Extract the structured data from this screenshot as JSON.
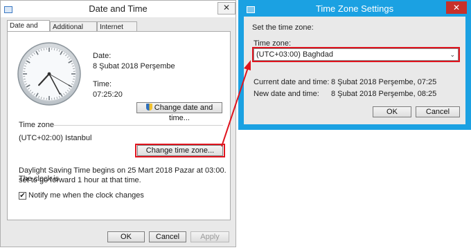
{
  "date_time_window": {
    "title": "Date and Time",
    "close_glyph": "✕",
    "tabs": [
      {
        "label": "Date and Time"
      },
      {
        "label": "Additional Clocks"
      },
      {
        "label": "Internet Time"
      }
    ],
    "date_label": "Date:",
    "date_value": "8 Şubat 2018 Perşembe",
    "time_label": "Time:",
    "time_value": "07:25:20",
    "change_date_button": "Change date and time...",
    "time_zone_heading": "Time zone",
    "time_zone_value": "(UTC+02:00) Istanbul",
    "change_time_zone_button": "Change time zone...",
    "dst_text_line1": "Daylight Saving Time begins on 25 Mart 2018 Pazar at 03:00. The clock is",
    "dst_text_line2": "set to go forward 1 hour at that time.",
    "notify_label": "Notify me when the clock changes",
    "notify_checked": true,
    "buttons": {
      "ok": "OK",
      "cancel": "Cancel",
      "apply": "Apply"
    }
  },
  "time_zone_window": {
    "title": "Time Zone Settings",
    "close_glyph": "✕",
    "instruction": "Set the time zone:",
    "field_label": "Time zone:",
    "selected_zone": "(UTC+03:00) Baghdad",
    "current_label": "Current date and time:",
    "current_value": "8 Şubat 2018 Perşembe, 07:25",
    "new_label": "New date and time:",
    "new_value": "8 Şubat 2018 Perşembe, 08:25",
    "buttons": {
      "ok": "OK",
      "cancel": "Cancel"
    }
  },
  "colors": {
    "highlight": "#e0141e",
    "tz_titlebar": "#1ba1e2",
    "tz_close": "#c7302a"
  }
}
